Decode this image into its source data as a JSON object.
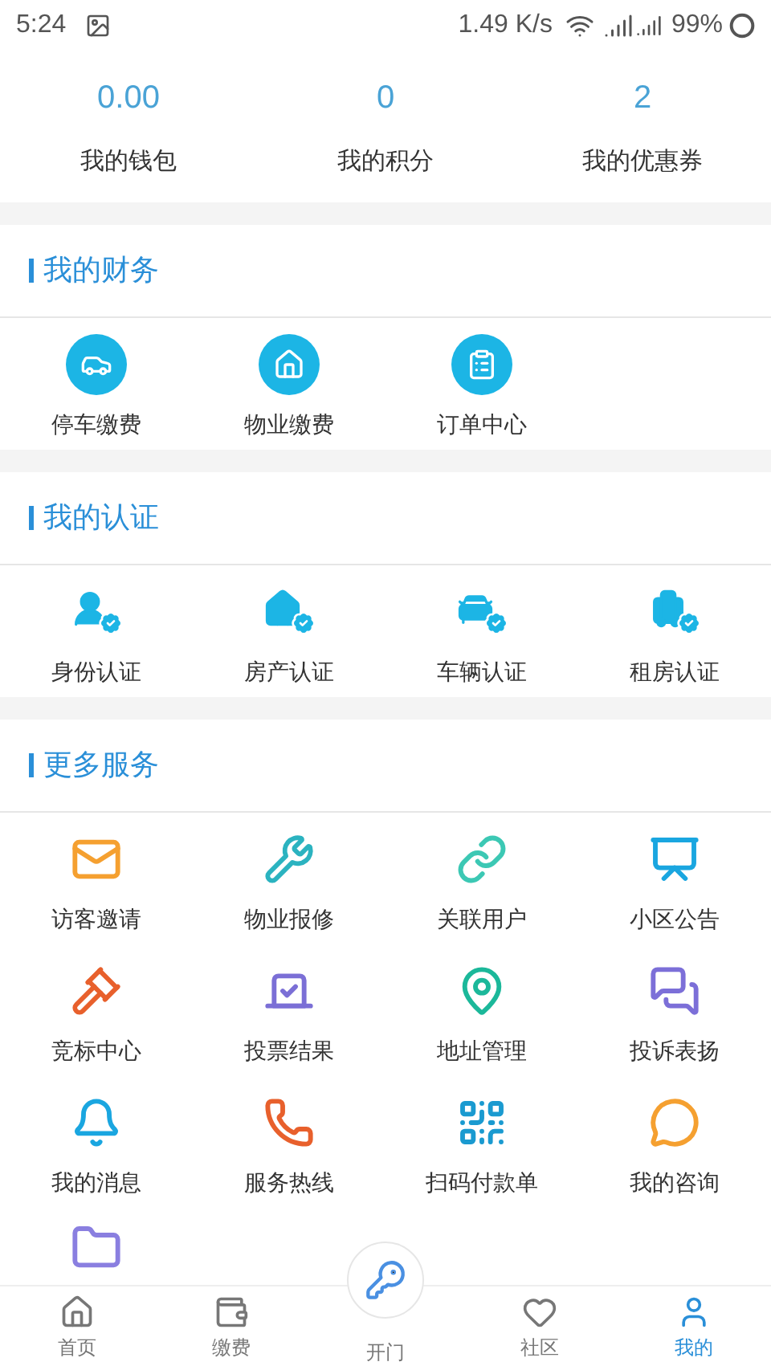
{
  "status_bar": {
    "time": "5:24",
    "speed": "1.49 K/s",
    "battery": "99%"
  },
  "stats": [
    {
      "value": "0.00",
      "label": "我的钱包"
    },
    {
      "value": "0",
      "label": "我的积分"
    },
    {
      "value": "2",
      "label": "我的优惠券"
    }
  ],
  "sections": [
    {
      "title": "我的财务",
      "items": [
        {
          "label": "停车缴费"
        },
        {
          "label": "物业缴费"
        },
        {
          "label": "订单中心"
        }
      ]
    },
    {
      "title": "我的认证",
      "items": [
        {
          "label": "身份认证"
        },
        {
          "label": "房产认证"
        },
        {
          "label": "车辆认证"
        },
        {
          "label": "租房认证"
        }
      ]
    },
    {
      "title": "更多服务",
      "items": [
        {
          "label": "访客邀请"
        },
        {
          "label": "物业报修"
        },
        {
          "label": "关联用户"
        },
        {
          "label": "小区公告"
        },
        {
          "label": "竞标中心"
        },
        {
          "label": "投票结果"
        },
        {
          "label": "地址管理"
        },
        {
          "label": "投诉表扬"
        },
        {
          "label": "我的消息"
        },
        {
          "label": "服务热线"
        },
        {
          "label": "扫码付款单"
        },
        {
          "label": "我的咨询"
        },
        {
          "kind": "icon_only"
        }
      ]
    }
  ],
  "bottom_nav": [
    {
      "label": "首页",
      "selected": false
    },
    {
      "label": "缴费",
      "selected": false
    },
    {
      "label": "开门",
      "selected": false
    },
    {
      "label": "社区",
      "selected": false
    },
    {
      "label": "我的",
      "selected": true
    }
  ]
}
